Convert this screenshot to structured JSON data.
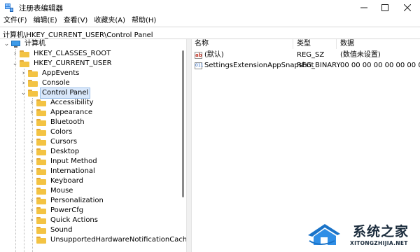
{
  "window": {
    "title": "注册表编辑器"
  },
  "menu": [
    "文件(F)",
    "编辑(E)",
    "查看(V)",
    "收藏夹(A)",
    "帮助(H)"
  ],
  "address": "计算机\\HKEY_CURRENT_USER\\Control Panel",
  "tree": {
    "root": "计算机",
    "hkcr": "HKEY_CLASSES_ROOT",
    "hkcu": "HKEY_CURRENT_USER",
    "hkcu_children": [
      "AppEvents",
      "Console"
    ],
    "selected": "Control Panel",
    "control_panel_children": [
      "Accessibility",
      "Appearance",
      "Bluetooth",
      "Colors",
      "Cursors",
      "Desktop",
      "Input Method",
      "International",
      "Keyboard",
      "Mouse",
      "Personalization",
      "PowerCfg",
      "Quick Actions",
      "Sound",
      "UnsupportedHardwareNotificationCache"
    ]
  },
  "list": {
    "columns": [
      "名称",
      "类型",
      "数据"
    ],
    "rows": [
      {
        "name": "(默认)",
        "type": "REG_SZ",
        "data": "(数值未设置)",
        "icon": "string-value-icon"
      },
      {
        "name": "SettingsExtensionAppSnapshot",
        "type": "REG_BINARY",
        "data": "00 00 00 00 00 00 00 00",
        "icon": "binary-value-icon"
      }
    ]
  },
  "watermark": {
    "cn": "系统之家",
    "en": "XITONGZHIJIA.NET"
  },
  "colors": {
    "selection": "#d9e8fb",
    "folder": "#f3c343",
    "accent": "#1a73c8"
  }
}
